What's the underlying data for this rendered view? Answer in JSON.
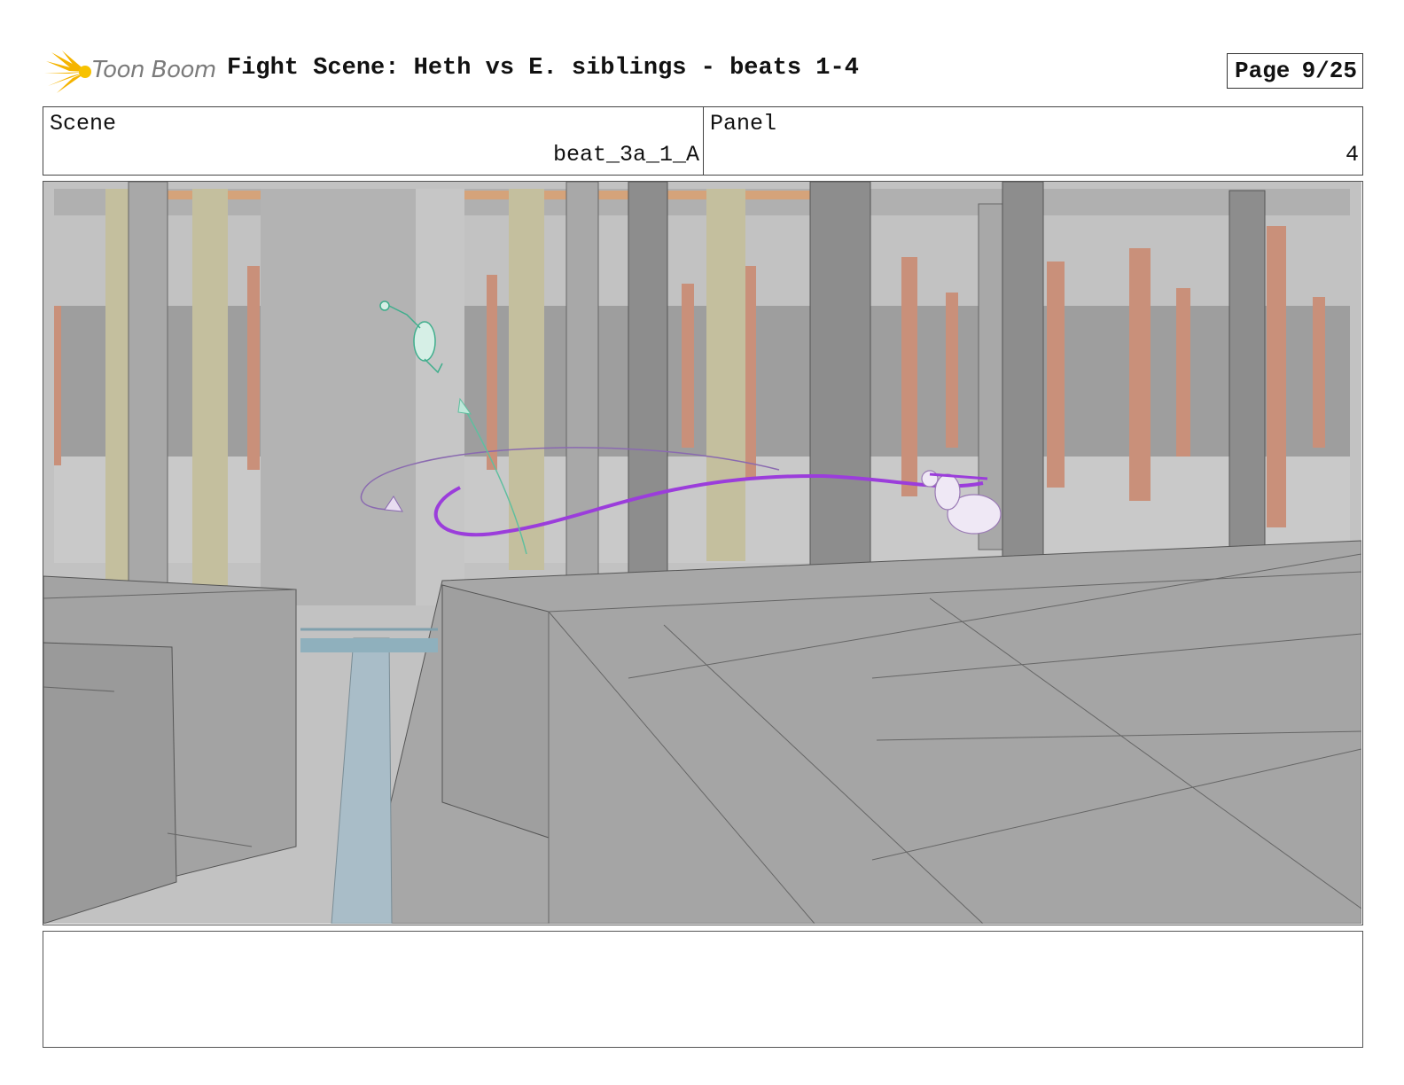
{
  "header": {
    "logo_text": "Toon Boom",
    "title": "Fight Scene: Heth vs E. siblings - beats 1-4",
    "page_label": "Page",
    "page_number": "9/25"
  },
  "info": {
    "scene_label": "Scene",
    "scene_value": "beat_3a_1_A",
    "panel_label": "Panel",
    "panel_value": "4"
  },
  "panel": {
    "colors": {
      "background": "#b8b8b8",
      "floor": "#a7a7a7",
      "dark_column": "#8d8d8d",
      "tan_column": "#c4bf9e",
      "orange_column": "#c9907a",
      "bridge": "#a9bdc8",
      "action_line": "#9b3ddb",
      "arrow_line": "#5fbf9f"
    }
  },
  "notes": {
    "text": ""
  }
}
